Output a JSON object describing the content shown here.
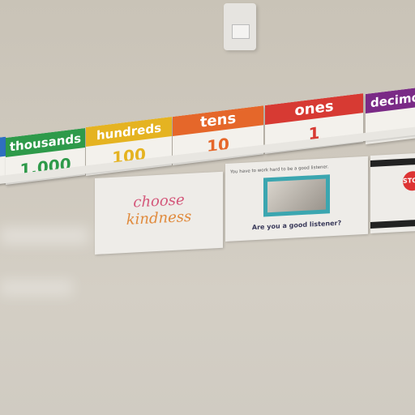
{
  "place_value_cards": [
    {
      "label": "thousands",
      "value": "1,000",
      "color": "#2e9a4a"
    },
    {
      "label": "hundreds",
      "value": "100",
      "color": "#e5b321"
    },
    {
      "label": "tens",
      "value": "10",
      "color": "#e5672a"
    },
    {
      "label": "ones",
      "value": "1",
      "color": "#d73a33"
    },
    {
      "label": "decimo",
      "value": "",
      "color": "#7a2a86"
    }
  ],
  "posters": {
    "kindness": {
      "line1": "choose",
      "line2": "kindness"
    },
    "listener": {
      "caption": "You have to work hard to be a good listener.",
      "question": "Are you a good listener?"
    },
    "stop": {
      "sign": "STO"
    }
  }
}
